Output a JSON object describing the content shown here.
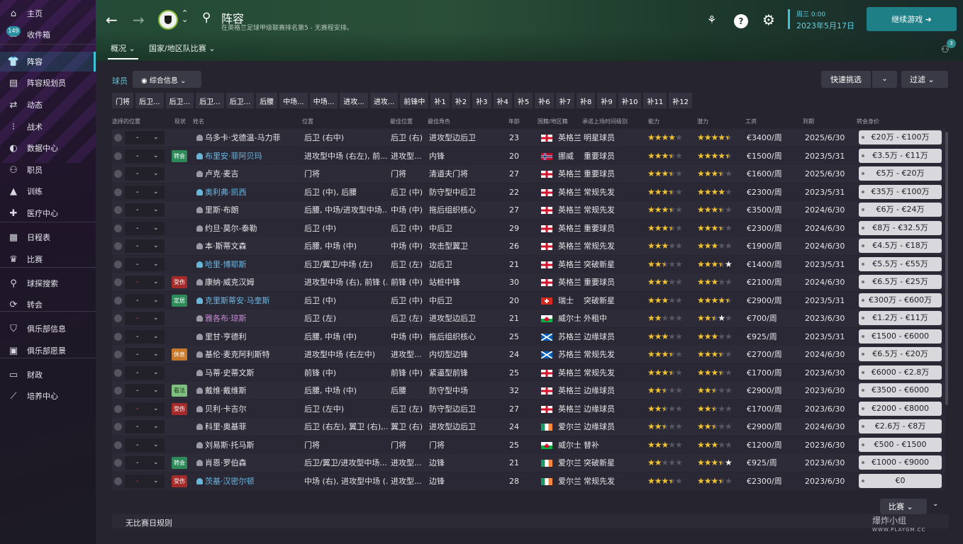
{
  "sidebar": {
    "items": [
      {
        "label": "主页",
        "icon": "home-icon",
        "glyph": "⌂"
      },
      {
        "label": "收件箱",
        "icon": "inbox-icon",
        "glyph": "✉",
        "badge": "149"
      },
      {
        "label": "阵容",
        "icon": "shirt-icon",
        "glyph": "👕"
      },
      {
        "label": "阵容规划员",
        "icon": "clipboard-icon",
        "glyph": "▤"
      },
      {
        "label": "动态",
        "icon": "dynamics-icon",
        "glyph": "⇄"
      },
      {
        "label": "战术",
        "icon": "tactics-icon",
        "glyph": "⁝"
      },
      {
        "label": "数据中心",
        "icon": "data-hub-icon",
        "glyph": "◐"
      },
      {
        "label": "职员",
        "icon": "staff-icon",
        "glyph": "⚇"
      },
      {
        "label": "训练",
        "icon": "training-icon",
        "glyph": "▲"
      },
      {
        "label": "医疗中心",
        "icon": "medical-icon",
        "glyph": "✚"
      },
      {
        "label": "日程表",
        "icon": "calendar-icon",
        "glyph": "▦"
      },
      {
        "label": "比赛",
        "icon": "trophy-icon",
        "glyph": "♛"
      },
      {
        "label": "球探搜索",
        "icon": "search-icon",
        "glyph": "⚲"
      },
      {
        "label": "转会",
        "icon": "transfer-icon",
        "glyph": "⟳"
      },
      {
        "label": "俱乐部信息",
        "icon": "shield-icon",
        "glyph": "⛉"
      },
      {
        "label": "俱乐部愿景",
        "icon": "briefcase-icon",
        "glyph": "▣"
      },
      {
        "label": "财政",
        "icon": "finance-icon",
        "glyph": "▭"
      },
      {
        "label": "培养中心",
        "icon": "development-icon",
        "glyph": "⟋"
      }
    ]
  },
  "header": {
    "title": "阵容",
    "subtitle": "在英格兰足球甲级联赛排名第5 - 无赛程安排。",
    "tabs": [
      "概况 ⌄",
      "国家/地区队比赛 ⌄"
    ],
    "date_line1": "周三 0:00",
    "date_line2": "2023年5月17日",
    "continue_label": "继续游戏 ➜",
    "notif_count": "3",
    "help_glyph": "?",
    "settings_glyph": "⚙"
  },
  "toolbar": {
    "players_label": "球员",
    "view_label": "◉  综合信息  ⌄",
    "quick_pick": "快速挑选",
    "filter": "过滤  ⌄"
  },
  "position_tabs": [
    "门将",
    "后卫...",
    "后卫...",
    "后卫...",
    "后卫...",
    "后腰",
    "中场...",
    "中场...",
    "进攻...",
    "进攻...",
    "前锋中",
    "补1",
    "补2",
    "补3",
    "补4",
    "补5",
    "补6",
    "补7",
    "补8",
    "补9",
    "补10",
    "补11",
    "补12"
  ],
  "columns": [
    "选择的位置",
    "现状",
    "姓名",
    "位置",
    "最佳位置",
    "最佳角色",
    "年龄",
    "国籍/地区籍",
    "承诺上场时间级别",
    "能力",
    "潜力",
    "工资",
    "到期",
    "转会身价"
  ],
  "colors": {
    "accent": "#3ec4d6",
    "continue_bg": "#1f7f86",
    "star": "#f1c232",
    "link": "#6ab9e6"
  },
  "players": [
    {
      "name": "乌多卡·戈德温-马力菲",
      "pos": "后卫 (右中)",
      "best": "后卫 (右)",
      "role": "进攻型边后卫",
      "age": "23",
      "nat": "英格兰",
      "flag": "eng",
      "squad": "明星球员",
      "ca": 4,
      "pa": 4.5,
      "wage": "€3400/周",
      "exp": "2025/6/30",
      "value": "€20万 - €100万",
      "status": "",
      "dash": "-",
      "link": false
    },
    {
      "name": "布里安·菲阿贝玛",
      "pos": "进攻型中场 (右左), 前...",
      "best": "进攻型...",
      "role": "内锋",
      "age": "20",
      "nat": "挪威",
      "flag": "nor",
      "squad": "重要球员",
      "ca": 3.5,
      "pa": 4.5,
      "paw": true,
      "wage": "€1500/周",
      "exp": "2023/5/31",
      "value": "€3.5万 - €11万",
      "status": "转会",
      "stype": "green",
      "dash": "-",
      "link": true
    },
    {
      "name": "卢克·麦吉",
      "pos": "门将",
      "best": "门将",
      "role": "清道夫门将",
      "age": "27",
      "nat": "英格兰",
      "flag": "eng",
      "squad": "重要球员",
      "ca": 3.5,
      "pa": 3.5,
      "wage": "€1600/周",
      "exp": "2025/6/30",
      "value": "€5万 - €20万",
      "status": "",
      "dash": "-",
      "link": false
    },
    {
      "name": "奥利弗·凯西",
      "pos": "后卫 (中), 后腰",
      "best": "后卫 (中)",
      "role": "防守型中后卫",
      "age": "22",
      "nat": "英格兰",
      "flag": "eng",
      "squad": "常规先发",
      "ca": 3.5,
      "pa": 4,
      "wage": "€2300/周",
      "exp": "2023/5/31",
      "value": "€35万 - €100万",
      "status": "",
      "dash": "-",
      "link": true
    },
    {
      "name": "里斯·布朗",
      "pos": "后腰, 中场/进攻型中场...",
      "best": "中场 (中)",
      "role": "拖后组织核心",
      "age": "27",
      "nat": "英格兰",
      "flag": "eng",
      "squad": "常规先发",
      "ca": 3.5,
      "pa": 3.5,
      "wage": "€3500/周",
      "exp": "2024/6/30",
      "value": "€6万 - €24万",
      "status": "",
      "dash": "-",
      "link": false
    },
    {
      "name": "约旦·莫尔-泰勒",
      "pos": "后卫 (中)",
      "best": "后卫 (中)",
      "role": "中后卫",
      "age": "29",
      "nat": "英格兰",
      "flag": "eng",
      "squad": "重要球员",
      "ca": 3.5,
      "pa": 3.5,
      "wage": "€2300/周",
      "exp": "2024/6/30",
      "value": "€8万 - €32.5万",
      "status": "",
      "dash": "-",
      "link": false
    },
    {
      "name": "本·斯蒂文森",
      "pos": "后腰, 中场 (中)",
      "best": "中场 (中)",
      "role": "攻击型翼卫",
      "age": "26",
      "nat": "英格兰",
      "flag": "eng",
      "squad": "常规先发",
      "ca": 3,
      "pa": 3,
      "wage": "€1900/周",
      "exp": "2024/6/30",
      "value": "€4.5万 - €18万",
      "status": "",
      "dash": "-",
      "link": false
    },
    {
      "name": "哈里·博耶斯",
      "pos": "后卫/翼卫/中场 (左)",
      "best": "后卫 (左)",
      "role": "边后卫",
      "age": "21",
      "nat": "英格兰",
      "flag": "eng",
      "squad": "突破新星",
      "ca": 2.5,
      "pa": 3.5,
      "paw": true,
      "wage": "€1400/周",
      "exp": "2023/5/31",
      "value": "€5.5万 - €55万",
      "status": "",
      "dash": "-",
      "link": true
    },
    {
      "name": "康纳·威克汉姆",
      "pos": "进攻型中场 (右), 前锋 (...",
      "best": "前锋 (中)",
      "role": "站桩中锋",
      "age": "30",
      "nat": "英格兰",
      "flag": "eng",
      "squad": "重要球员",
      "ca": 3,
      "pa": 3,
      "wage": "€2100/周",
      "exp": "2024/6/30",
      "value": "€6.5万 - €25万",
      "status": "受伤",
      "stype": "red",
      "dash": "-",
      "dashred": true,
      "link": false
    },
    {
      "name": "克里斯蒂安·马奎斯",
      "pos": "后卫 (中)",
      "best": "后卫 (中)",
      "role": "中后卫",
      "age": "20",
      "nat": "瑞士",
      "flag": "sui",
      "squad": "突破新星",
      "ca": 3,
      "pa": 4.5,
      "paw": true,
      "wage": "€2900/周",
      "exp": "2023/5/31",
      "value": "€300万 - €600万",
      "status": "定居",
      "stype": "green",
      "dash": "-",
      "link": true
    },
    {
      "name": "雅各布·琼斯",
      "pos": "后卫 (左)",
      "best": "后卫 (左)",
      "role": "进攻型边后卫",
      "age": "21",
      "nat": "威尔士",
      "flag": "wal",
      "squad": "外租中",
      "ca": 2,
      "pa": 2.5,
      "paw": true,
      "wage": "€700/周",
      "exp": "2023/6/30",
      "value": "€1.2万 - €11万",
      "status": "",
      "dash": "-",
      "dashred": true,
      "link": false,
      "pink": true
    },
    {
      "name": "里甘·亨德利",
      "pos": "后腰, 中场 (中)",
      "best": "中场 (中)",
      "role": "拖后组织核心",
      "age": "25",
      "nat": "苏格兰",
      "flag": "sco",
      "squad": "边缘球员",
      "ca": 3,
      "pa": 3,
      "wage": "€925/周",
      "exp": "2023/5/31",
      "value": "€1500 - €6000",
      "status": "",
      "dash": "-",
      "link": false
    },
    {
      "name": "基伦·麦克阿利斯特",
      "pos": "进攻型中场 (右左中)",
      "best": "进攻型...",
      "role": "内切型边锋",
      "age": "24",
      "nat": "苏格兰",
      "flag": "sco",
      "squad": "常规先发",
      "ca": 3.5,
      "pa": 3.5,
      "wage": "€2700/周",
      "exp": "2024/6/30",
      "value": "€6.5万 - €20万",
      "status": "休息",
      "stype": "orange",
      "dash": "-",
      "link": false
    },
    {
      "name": "马蒂·史蒂文斯",
      "pos": "前锋 (中)",
      "best": "前锋 (中)",
      "role": "紧逼型前锋",
      "age": "25",
      "nat": "英格兰",
      "flag": "eng",
      "squad": "常规先发",
      "ca": 3.5,
      "pa": 3.5,
      "wage": "€1700/周",
      "exp": "2023/6/30",
      "value": "€6000 - €2.8万",
      "status": "",
      "dash": "-",
      "link": false
    },
    {
      "name": "戴维·戴维斯",
      "pos": "后腰, 中场 (中)",
      "best": "后腰",
      "role": "防守型中场",
      "age": "32",
      "nat": "英格兰",
      "flag": "eng",
      "squad": "边缘球员",
      "ca": 2.5,
      "pa": 2.5,
      "wage": "€2900/周",
      "exp": "2023/6/30",
      "value": "€3500 - €6000",
      "status": "看法",
      "stype": "lightgreen",
      "dash": "-",
      "link": false
    },
    {
      "name": "贝利·卡吉尔",
      "pos": "后卫 (左中)",
      "best": "后卫 (左)",
      "role": "防守型边后卫",
      "age": "27",
      "nat": "英格兰",
      "flag": "eng",
      "squad": "边缘球员",
      "ca": 2.5,
      "pa": 2.5,
      "wage": "€1700/周",
      "exp": "2023/6/30",
      "value": "€2000 - €8000",
      "status": "受伤",
      "stype": "red",
      "dash": "-",
      "dashred": true,
      "link": false
    },
    {
      "name": "科里·奥基菲",
      "pos": "后卫 (右左), 翼卫 (右),...",
      "best": "翼卫 (右)",
      "role": "进攻型边后卫",
      "age": "24",
      "nat": "爱尔兰",
      "flag": "irl",
      "squad": "边缘球员",
      "ca": 2.5,
      "pa": 2.5,
      "wage": "€2900/周",
      "exp": "2024/6/30",
      "value": "€2.6万 - €8万",
      "status": "",
      "dash": "-",
      "link": false
    },
    {
      "name": "刘易斯·托马斯",
      "pos": "门将",
      "best": "门将",
      "role": "门将",
      "age": "25",
      "nat": "威尔士",
      "flag": "wal",
      "squad": "替补",
      "ca": 3,
      "pa": 3,
      "wage": "€1200/周",
      "exp": "2023/6/30",
      "value": "€500 - €1500",
      "status": "",
      "dash": "-",
      "link": false
    },
    {
      "name": "肖恩·罗伯森",
      "pos": "后卫/翼卫/进攻型中场...",
      "best": "进攻型...",
      "role": "边锋",
      "age": "21",
      "nat": "爱尔兰",
      "flag": "irl",
      "squad": "突破新星",
      "ca": 2,
      "pa": 3.5,
      "paw": true,
      "wage": "€925/周",
      "exp": "2023/6/30",
      "value": "€1000 - €9000",
      "status": "转会",
      "stype": "green",
      "dash": "-",
      "link": false
    },
    {
      "name": "茨基·汉密尔顿",
      "pos": "中场 (右), 进攻型中场 (...",
      "best": "进攻型...",
      "role": "边锋",
      "age": "28",
      "nat": "爱尔兰",
      "flag": "irl",
      "squad": "常规先发",
      "ca": 3.5,
      "pa": 3.5,
      "wage": "€2300/周",
      "exp": "2023/6/30",
      "value": "€0",
      "status": "受伤",
      "stype": "red",
      "dash": "-",
      "dashred": true,
      "link": true
    }
  ],
  "footer": {
    "match_btn": "比赛  ⌄",
    "rule_text": "无比赛日规则",
    "watermark": "爆炸小组",
    "watermark_sub": "WWW.PLAYGM.CC"
  }
}
